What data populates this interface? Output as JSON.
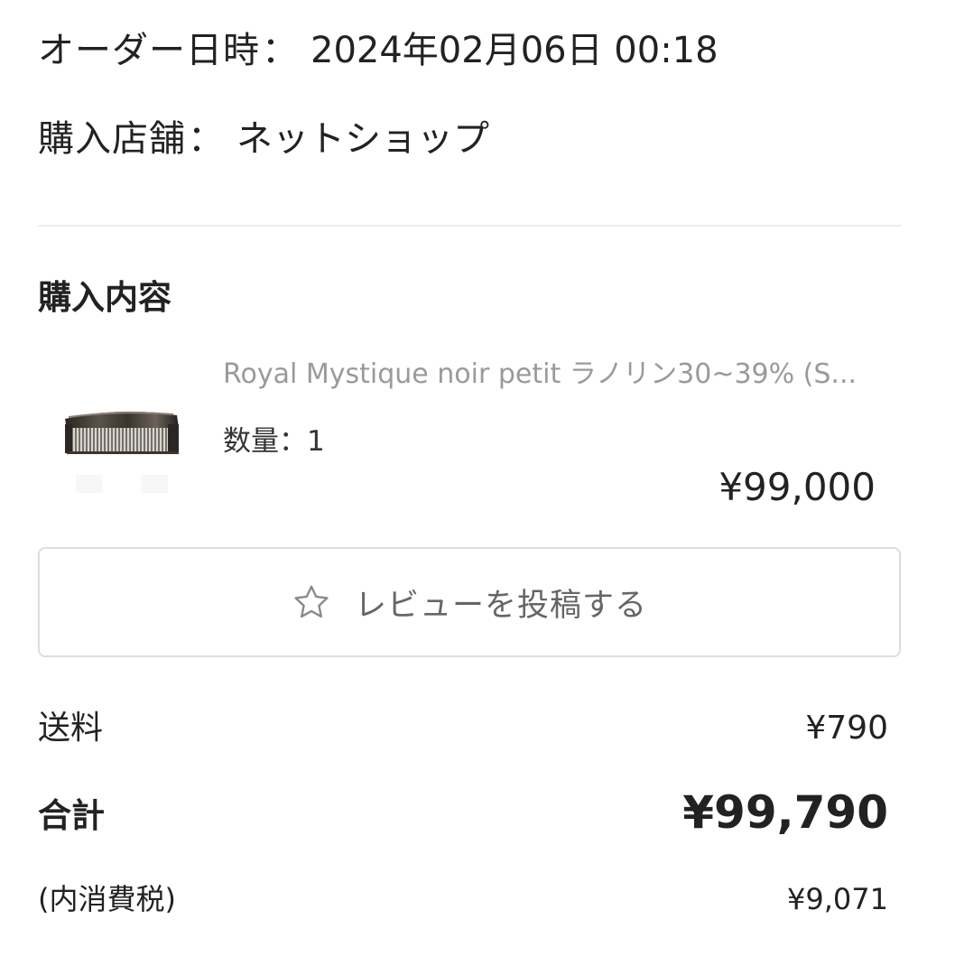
{
  "order": {
    "datetime_label": "オーダー日時",
    "datetime_value": "2024年02月06日 00:18",
    "store_label": "購入店舗",
    "store_value": "ネットショップ",
    "separator": "："
  },
  "purchase": {
    "section_title": "購入内容",
    "item": {
      "thumbnail_icon": "comb-product-image",
      "name": "Royal Mystique noir petit ラノリン30~39% (S...",
      "quantity_label": "数量",
      "quantity_separator": "：",
      "quantity_value": "1",
      "price": "¥99,000"
    },
    "review_button": {
      "icon": "star-outline-icon",
      "label": "レビューを投稿する"
    }
  },
  "summary": {
    "shipping_label": "送料",
    "shipping_value": "¥790",
    "total_label": "合計",
    "total_value": "¥99,790",
    "tax_label": "(内消費税)",
    "tax_value": "¥9,071"
  },
  "colors": {
    "text_primary": "#222222",
    "text_muted": "#9a9a9a",
    "border": "#dddddd",
    "divider": "#ececec"
  }
}
